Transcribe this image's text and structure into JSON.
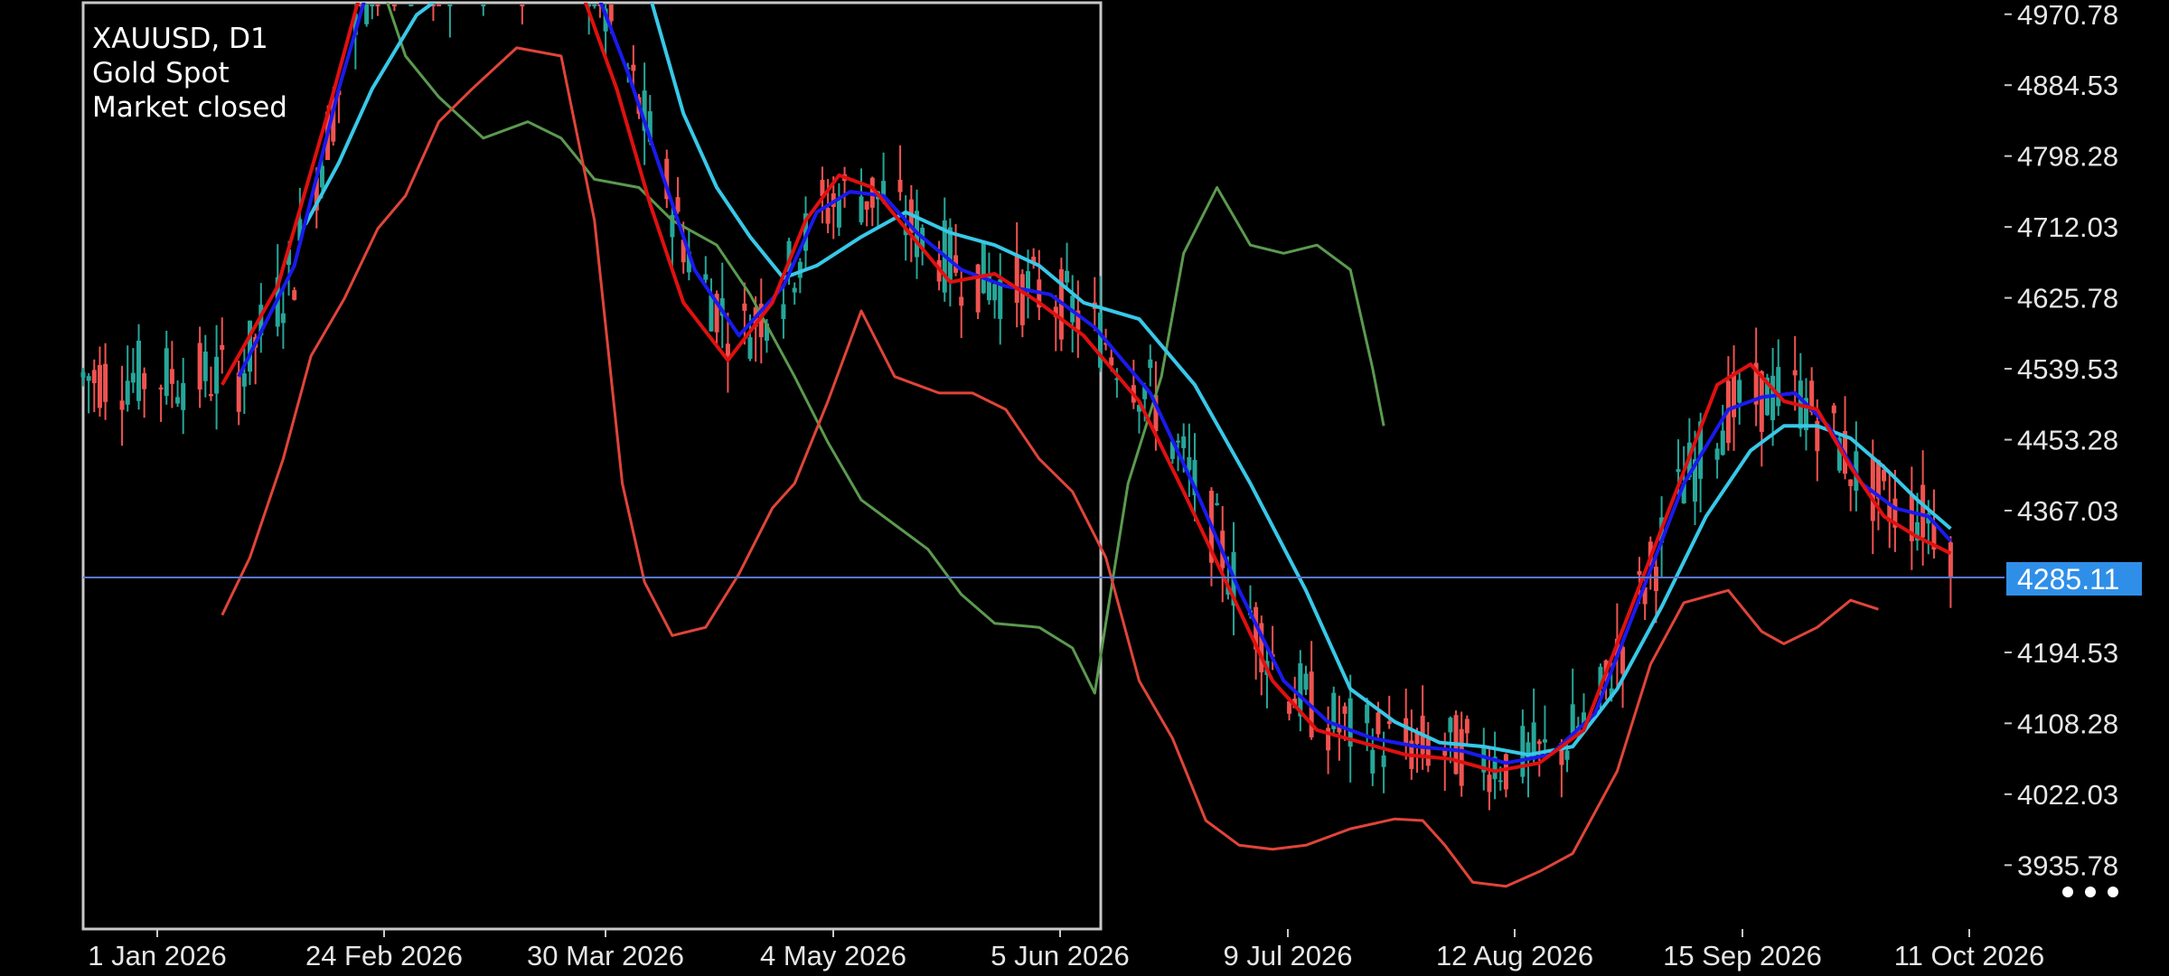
{
  "header": {
    "symbol_line": "XAUUSD, D1",
    "instrument": "Gold Spot",
    "status": "Market closed"
  },
  "price_axis": {
    "labels": [
      "4970.78",
      "4884.53",
      "4798.28",
      "4712.03",
      "4625.78",
      "4539.53",
      "4453.28",
      "4367.03",
      "4194.53",
      "4108.28",
      "4022.03",
      "3935.78"
    ],
    "current_price": "4285.11"
  },
  "time_axis": {
    "labels": [
      "1 Jan 2026",
      "24 Feb 2026",
      "30 Mar 2026",
      "4 May 2026",
      "5 Jun 2026",
      "9 Jul 2026",
      "12 Aug 2026",
      "15 Sep 2026",
      "11 Oct 2026"
    ]
  },
  "menu": {
    "icon": "more-horizontal-icon"
  },
  "colors": {
    "background": "#000000",
    "bull_candle": "#26a69a",
    "bear_candle": "#ef5350",
    "bollinger_upper": "#5b9a4f",
    "bollinger_lower": "#e0443a",
    "ma_fast": "#e01010",
    "ma_mid": "#1a1aee",
    "ma_slow": "#38c8e8",
    "price_line": "#5a78d0",
    "price_tag": "#2f8fe8",
    "axis": "#c8c8c8"
  },
  "chart_data": {
    "type": "candlestick",
    "title": "XAUUSD, D1",
    "ylim": [
      3860,
      5000
    ],
    "x_dates": [
      "2026-01-01",
      "2026-02-24",
      "2026-03-30",
      "2026-05-04",
      "2026-06-05",
      "2026-07-09",
      "2026-08-12",
      "2026-09-15",
      "2026-10-11"
    ],
    "current_price": 4285.11,
    "indicators": {
      "bollinger_upper": [
        [
          40,
          5100
        ],
        [
          52,
          5040
        ],
        [
          58,
          4920
        ],
        [
          64,
          4870
        ],
        [
          72,
          4820
        ],
        [
          80,
          4840
        ],
        [
          86,
          4820
        ],
        [
          92,
          4770
        ],
        [
          100,
          4760
        ],
        [
          106,
          4720
        ],
        [
          114,
          4690
        ],
        [
          120,
          4630
        ],
        [
          128,
          4530
        ],
        [
          134,
          4450
        ],
        [
          140,
          4380
        ],
        [
          146,
          4350
        ],
        [
          152,
          4320
        ],
        [
          158,
          4265
        ],
        [
          164,
          4230
        ],
        [
          172,
          4225
        ],
        [
          178,
          4200
        ],
        [
          182,
          4145
        ],
        [
          188,
          4400
        ],
        [
          194,
          4530
        ],
        [
          198,
          4680
        ],
        [
          204,
          4760
        ],
        [
          210,
          4690
        ],
        [
          216,
          4680
        ],
        [
          222,
          4690
        ],
        [
          228,
          4660
        ],
        [
          232,
          4540
        ],
        [
          234,
          4470
        ]
      ],
      "bollinger_lower": [
        [
          25,
          4240
        ],
        [
          30,
          4310
        ],
        [
          36,
          4430
        ],
        [
          41,
          4555
        ],
        [
          47,
          4625
        ],
        [
          53,
          4710
        ],
        [
          58,
          4750
        ],
        [
          64,
          4840
        ],
        [
          70,
          4880
        ],
        [
          78,
          4930
        ],
        [
          86,
          4920
        ],
        [
          92,
          4720
        ],
        [
          97,
          4400
        ],
        [
          101,
          4280
        ],
        [
          106,
          4215
        ],
        [
          112,
          4225
        ],
        [
          118,
          4290
        ],
        [
          124,
          4370
        ],
        [
          128,
          4400
        ],
        [
          134,
          4500
        ],
        [
          140,
          4610
        ],
        [
          146,
          4530
        ],
        [
          154,
          4510
        ],
        [
          160,
          4510
        ],
        [
          166,
          4490
        ],
        [
          172,
          4430
        ],
        [
          178,
          4390
        ],
        [
          184,
          4310
        ],
        [
          190,
          4160
        ],
        [
          196,
          4090
        ],
        [
          202,
          3990
        ],
        [
          208,
          3960
        ],
        [
          214,
          3955
        ],
        [
          220,
          3960
        ],
        [
          228,
          3980
        ],
        [
          236,
          3992
        ],
        [
          241,
          3990
        ],
        [
          245,
          3960
        ],
        [
          250,
          3915
        ],
        [
          256,
          3910
        ],
        [
          262,
          3928
        ],
        [
          268,
          3950
        ],
        [
          276,
          4050
        ],
        [
          282,
          4180
        ],
        [
          288,
          4255
        ],
        [
          296,
          4270
        ],
        [
          302,
          4220
        ],
        [
          306,
          4205
        ],
        [
          312,
          4225
        ],
        [
          318,
          4258
        ],
        [
          323,
          4247
        ]
      ],
      "ma_fast": [
        [
          25,
          4520
        ],
        [
          35,
          4640
        ],
        [
          44,
          4850
        ],
        [
          50,
          5000
        ],
        [
          88,
          5030
        ],
        [
          96,
          4880
        ],
        [
          102,
          4740
        ],
        [
          108,
          4620
        ],
        [
          116,
          4550
        ],
        [
          124,
          4620
        ],
        [
          130,
          4720
        ],
        [
          136,
          4775
        ],
        [
          142,
          4760
        ],
        [
          148,
          4710
        ],
        [
          156,
          4645
        ],
        [
          164,
          4655
        ],
        [
          172,
          4620
        ],
        [
          180,
          4580
        ],
        [
          190,
          4500
        ],
        [
          198,
          4390
        ],
        [
          206,
          4275
        ],
        [
          214,
          4160
        ],
        [
          222,
          4100
        ],
        [
          230,
          4085
        ],
        [
          238,
          4070
        ],
        [
          246,
          4065
        ],
        [
          254,
          4050
        ],
        [
          262,
          4060
        ],
        [
          270,
          4100
        ],
        [
          278,
          4240
        ],
        [
          286,
          4380
        ],
        [
          294,
          4520
        ],
        [
          300,
          4545
        ],
        [
          306,
          4500
        ],
        [
          312,
          4490
        ],
        [
          318,
          4420
        ],
        [
          324,
          4360
        ],
        [
          330,
          4335
        ],
        [
          336,
          4315
        ]
      ],
      "ma_mid": [
        [
          28,
          4530
        ],
        [
          38,
          4665
        ],
        [
          46,
          4880
        ],
        [
          52,
          5020
        ],
        [
          90,
          5040
        ],
        [
          98,
          4900
        ],
        [
          104,
          4780
        ],
        [
          110,
          4660
        ],
        [
          118,
          4580
        ],
        [
          126,
          4640
        ],
        [
          132,
          4730
        ],
        [
          138,
          4755
        ],
        [
          144,
          4750
        ],
        [
          150,
          4705
        ],
        [
          158,
          4660
        ],
        [
          166,
          4640
        ],
        [
          174,
          4630
        ],
        [
          182,
          4590
        ],
        [
          192,
          4510
        ],
        [
          200,
          4395
        ],
        [
          208,
          4270
        ],
        [
          216,
          4160
        ],
        [
          224,
          4110
        ],
        [
          232,
          4090
        ],
        [
          240,
          4080
        ],
        [
          248,
          4075
        ],
        [
          256,
          4060
        ],
        [
          264,
          4070
        ],
        [
          272,
          4120
        ],
        [
          280,
          4260
        ],
        [
          288,
          4400
        ],
        [
          296,
          4490
        ],
        [
          302,
          4505
        ],
        [
          308,
          4510
        ],
        [
          314,
          4470
        ],
        [
          320,
          4400
        ],
        [
          326,
          4370
        ],
        [
          332,
          4360
        ],
        [
          336,
          4330
        ]
      ],
      "ma_slow": [
        [
          40,
          4715
        ],
        [
          46,
          4790
        ],
        [
          52,
          4880
        ],
        [
          60,
          4970
        ],
        [
          74,
          5040
        ],
        [
          100,
          5040
        ],
        [
          108,
          4850
        ],
        [
          114,
          4760
        ],
        [
          120,
          4700
        ],
        [
          126,
          4650
        ],
        [
          132,
          4665
        ],
        [
          140,
          4700
        ],
        [
          148,
          4730
        ],
        [
          156,
          4705
        ],
        [
          164,
          4690
        ],
        [
          172,
          4665
        ],
        [
          180,
          4620
        ],
        [
          190,
          4600
        ],
        [
          200,
          4520
        ],
        [
          210,
          4400
        ],
        [
          220,
          4270
        ],
        [
          228,
          4150
        ],
        [
          236,
          4110
        ],
        [
          244,
          4085
        ],
        [
          252,
          4080
        ],
        [
          260,
          4070
        ],
        [
          268,
          4080
        ],
        [
          276,
          4150
        ],
        [
          284,
          4250
        ],
        [
          292,
          4360
        ],
        [
          300,
          4440
        ],
        [
          306,
          4470
        ],
        [
          312,
          4470
        ],
        [
          318,
          4455
        ],
        [
          324,
          4420
        ],
        [
          330,
          4380
        ],
        [
          336,
          4345
        ]
      ]
    }
  }
}
